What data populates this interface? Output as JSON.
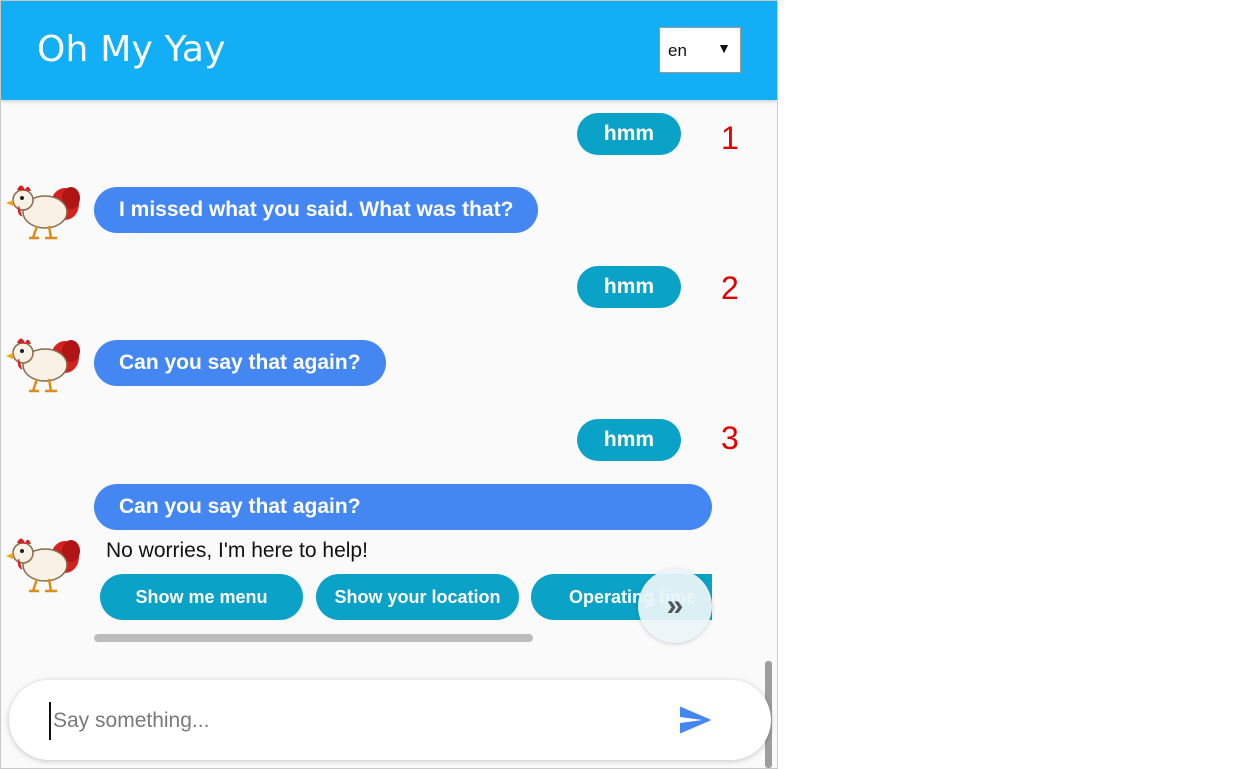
{
  "header": {
    "title": "Oh My Yay",
    "language": {
      "selected": "en",
      "arrow": "▼"
    }
  },
  "conversation": {
    "user_messages": [
      {
        "text": "hmm",
        "number": "1"
      },
      {
        "text": "hmm",
        "number": "2"
      },
      {
        "text": "hmm",
        "number": "3"
      }
    ],
    "bot_messages": [
      {
        "text": "I missed what you said. What was that?"
      },
      {
        "text": "Can you say that again?"
      },
      {
        "text": "Can you say that again?"
      }
    ],
    "bot_plain_text": "No worries, I'm here to help!",
    "quick_replies": [
      "Show me menu",
      "Show your location",
      "Operating time"
    ],
    "scroll_more_label": "»",
    "quick_replies_scroll_fraction": 0.71
  },
  "composer": {
    "placeholder": "Say something...",
    "send_icon": "send-icon"
  },
  "colors": {
    "header": "#12aef6",
    "user_bubble": "#0aa2c6",
    "bot_bubble": "#4487f3",
    "annotation": "#e00000",
    "send_icon": "#4487f3"
  }
}
